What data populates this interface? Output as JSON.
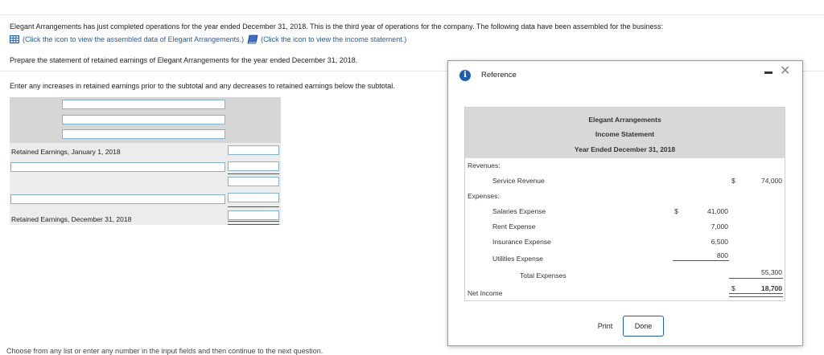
{
  "intro": "Elegant Arrangements has just completed operations for the year ended December 31, 2018. This is the third year of operations for the company. The following data have been assembled for the business:",
  "links": {
    "data_link": "(Click the icon to view the assembled data of Elegant Arrangements.)",
    "income_link": "(Click the icon to view the income statement.)"
  },
  "instructions": {
    "prepare": "Prepare the statement of retained earnings of Elegant Arrangements for the year ended December 31, 2018.",
    "enter": "Enter any increases in retained earnings prior to the subtotal and any decreases to retained earnings below the subtotal."
  },
  "worksheet": {
    "beginning_label": "Retained Earnings, January 1, 2018",
    "ending_label": "Retained Earnings, December 31, 2018"
  },
  "footer_text": "Choose from any list or enter any number in the input fields and then continue to the next question.",
  "dialog": {
    "title": "Reference",
    "statement": {
      "company": "Elegant Arrangements",
      "name": "Income Statement",
      "period": "Year Ended December 31, 2018",
      "revenues_label": "Revenues:",
      "service_revenue_label": "Service Revenue",
      "service_revenue_dollar": "$",
      "service_revenue_value": "74,000",
      "expenses_label": "Expenses:",
      "salaries_label": "Salaries Expense",
      "salaries_dollar": "$",
      "salaries_value": "41,000",
      "rent_label": "Rent Expense",
      "rent_value": "7,000",
      "insurance_label": "Insurance Expense",
      "insurance_value": "6,500",
      "utilities_label": "Utilities Expense",
      "utilities_value": "800",
      "total_expenses_label": "Total Expenses",
      "total_expenses_value": "55,300",
      "net_income_label": "Net Income",
      "net_income_dollar": "$",
      "net_income_value": "18,700"
    },
    "print_label": "Print",
    "done_label": "Done"
  },
  "colors": {
    "link": "#1a5fb4",
    "input_border": "#7fb3d5",
    "header_gray": "#d8d8d8"
  },
  "icons": {
    "data": "grid-icon",
    "income": "book-icon",
    "info": "info-icon",
    "minimize": "minimize-icon",
    "close": "close-icon"
  }
}
